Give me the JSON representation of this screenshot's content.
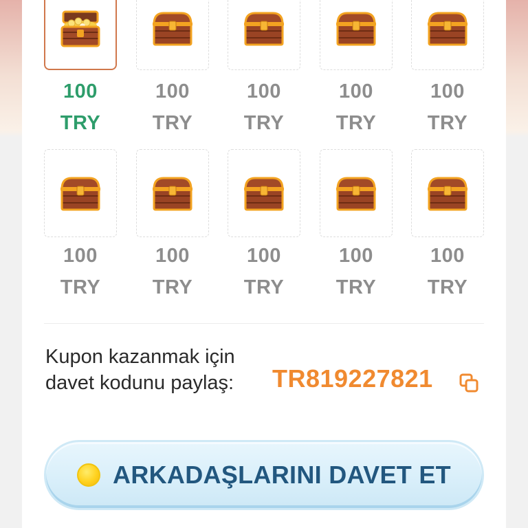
{
  "chests": [
    {
      "amount": "100",
      "currency": "TRY",
      "state": "opened",
      "selected": true
    },
    {
      "amount": "100",
      "currency": "TRY",
      "state": "closed",
      "selected": false
    },
    {
      "amount": "100",
      "currency": "TRY",
      "state": "closed",
      "selected": false
    },
    {
      "amount": "100",
      "currency": "TRY",
      "state": "closed",
      "selected": false
    },
    {
      "amount": "100",
      "currency": "TRY",
      "state": "closed",
      "selected": false
    },
    {
      "amount": "100",
      "currency": "TRY",
      "state": "closed",
      "selected": false
    },
    {
      "amount": "100",
      "currency": "TRY",
      "state": "closed",
      "selected": false
    },
    {
      "amount": "100",
      "currency": "TRY",
      "state": "closed",
      "selected": false
    },
    {
      "amount": "100",
      "currency": "TRY",
      "state": "closed",
      "selected": false
    },
    {
      "amount": "100",
      "currency": "TRY",
      "state": "closed",
      "selected": false
    }
  ],
  "invite": {
    "share_text": "Kupon kazanmak için davet kodunu paylaş:",
    "code": "TR819227821",
    "copy_icon": "copy-icon",
    "button_label": "ARKADAŞLARINI DAVET ET",
    "button_icon": "coin-icon"
  },
  "colors": {
    "active_amount": "#2e9d6b",
    "inactive_amount": "#8d8d8d",
    "code": "#f08a30",
    "selected_border": "#d0774b",
    "button_text": "#22577f"
  }
}
